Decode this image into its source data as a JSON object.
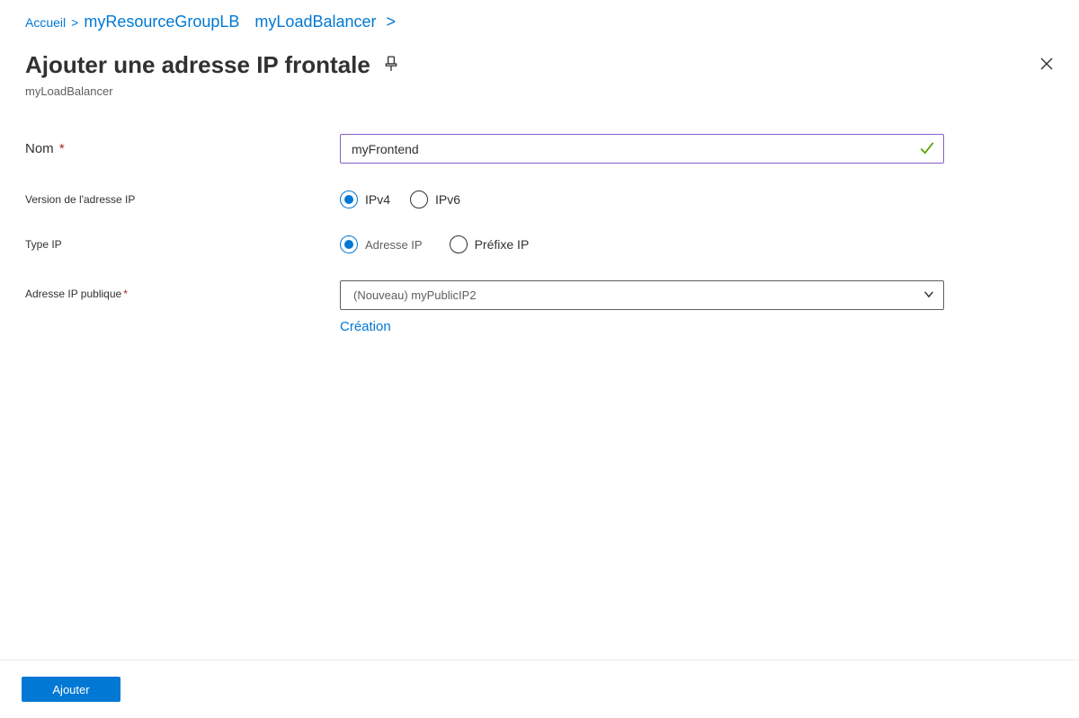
{
  "breadcrumb": {
    "home": "Accueil",
    "rg": "myResourceGroupLB",
    "lb": "myLoadBalancer"
  },
  "header": {
    "title": "Ajouter une adresse IP frontale",
    "subtitle": "myLoadBalancer"
  },
  "form": {
    "name_label": "Nom",
    "name_value": "myFrontend",
    "ip_version_label": "Version de l'adresse IP",
    "ipv4": "IPv4",
    "ipv6": "IPv6",
    "ip_type_label": "Type IP",
    "ip_address_opt": "Adresse IP",
    "ip_prefix_opt": "Préfixe IP",
    "public_ip_label": "Adresse IP publique",
    "public_ip_value": "(Nouveau) myPublicIP2",
    "create_link": "Création"
  },
  "footer": {
    "add_button": "Ajouter"
  }
}
